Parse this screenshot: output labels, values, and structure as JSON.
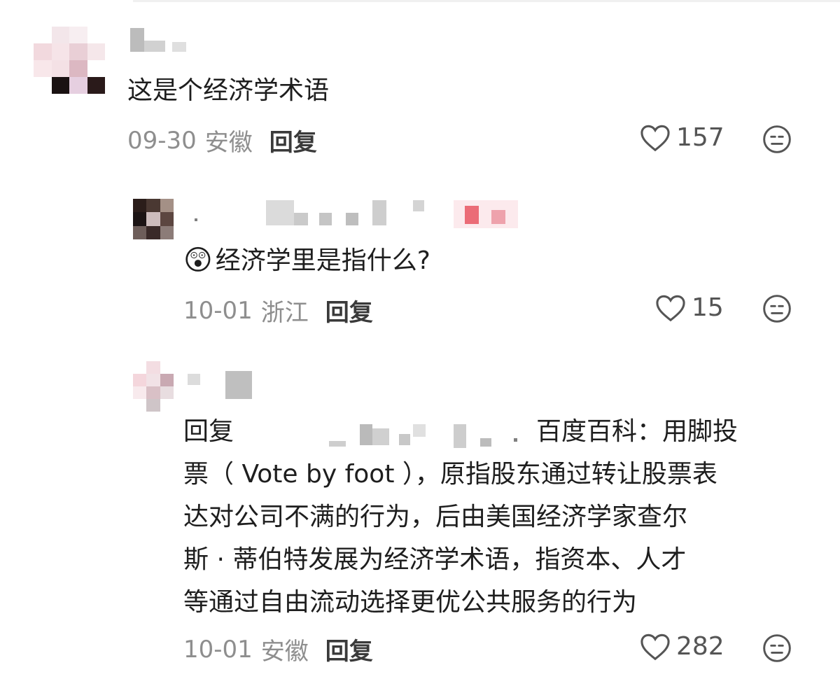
{
  "comments": [
    {
      "text": "这是个经济学术语",
      "date": "09-30",
      "location": "安徽",
      "reply_label": "回复",
      "likes": "157"
    },
    {
      "emoji": "😲",
      "text": "经济学里是指什么?",
      "date": "10-01",
      "location": "浙江",
      "reply_label": "回复",
      "likes": "15"
    },
    {
      "reply_prefix": "回复",
      "quote_head": "百度百科：用脚投",
      "lines": [
        "票（ Vote by foot ），原指股东通过转让股票表",
        "达对公司不满的行为，后由美国经济学家查尔",
        "斯 · 蒂伯特发展为经济学术语，指资本、人才",
        "等通过自由流动选择更优公共服务的行为"
      ],
      "date": "10-01",
      "location": "安徽",
      "reply_label": "回复",
      "likes": "282"
    }
  ],
  "icons": {
    "like": "heart-outline-icon",
    "dislike": "neutral-face-icon"
  },
  "colors": {
    "text": "#1e1e1e",
    "meta": "#8e8e8e",
    "icon": "#555555"
  }
}
